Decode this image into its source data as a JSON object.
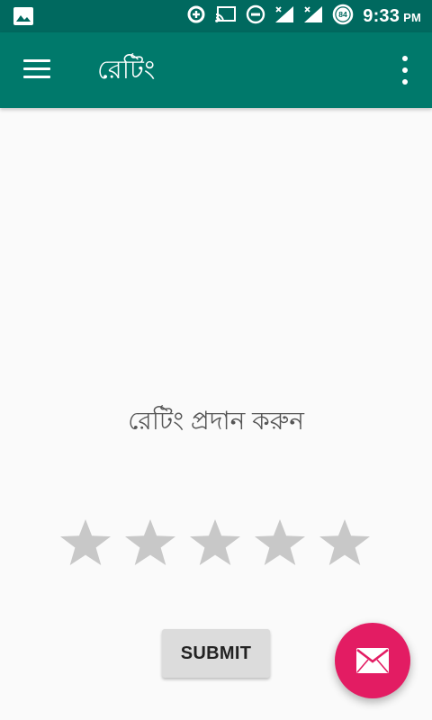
{
  "status_bar": {
    "time": "9:33",
    "ampm": "PM",
    "battery_level": "84",
    "icons": [
      "image-icon",
      "data-saver-icon",
      "cast-icon",
      "do-not-disturb-icon",
      "signal-icon",
      "signal-icon",
      "battery-icon"
    ]
  },
  "app_bar": {
    "title": "রেটিং",
    "menu_icon": "hamburger-menu-icon",
    "overflow_icon": "more-vert-icon",
    "color": "#00796b"
  },
  "main": {
    "prompt": "রেটিং প্রদান করুন",
    "rating": {
      "max": 5,
      "value": 0,
      "empty_color": "#c8c8c8"
    },
    "submit_label": "SUBMIT"
  },
  "fab": {
    "icon": "mail-icon",
    "color": "#e31c63"
  }
}
